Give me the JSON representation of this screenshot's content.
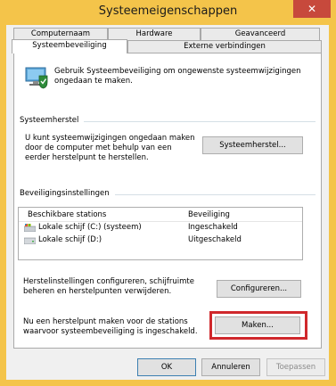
{
  "window": {
    "title": "Systeemeigenschappen",
    "close_glyph": "✕"
  },
  "tabs": {
    "row1": [
      "Computernaam",
      "Hardware",
      "Geavanceerd"
    ],
    "row2": [
      "Systeembeveiliging",
      "Externe verbindingen"
    ],
    "active": "Systeembeveiliging"
  },
  "intro": {
    "icon": "system-protection-icon",
    "text": "Gebruik Systeembeveiliging om ongewenste systeemwijzigingen ongedaan te maken."
  },
  "restore": {
    "group_label": "Systeemherstel",
    "description": "U kunt systeemwijzigingen ongedaan maken door de computer met behulp van een eerder herstelpunt te herstellen.",
    "button": "Systeemherstel..."
  },
  "protection": {
    "group_label": "Beveiligingsinstellingen",
    "columns": [
      "Beschikbare stations",
      "Beveiliging"
    ],
    "drives": [
      {
        "name": "Lokale schijf (C:) (systeem)",
        "status": "Ingeschakeld",
        "icon": "system-drive-icon"
      },
      {
        "name": "Lokale schijf (D:)",
        "status": "Uitgeschakeld",
        "icon": "drive-icon"
      }
    ],
    "configure_text": "Herstelinstellingen configureren, schijfruimte beheren en herstelpunten verwijderen.",
    "configure_button": "Configureren...",
    "create_text": "Nu een herstelpunt maken voor de stations waarvoor systeembeveiliging is ingeschakeld.",
    "create_button": "Maken..."
  },
  "footer": {
    "ok": "OK",
    "cancel": "Annuleren",
    "apply": "Toepassen"
  },
  "colors": {
    "titlebar": "#f4c44a",
    "close": "#c7493c",
    "highlight": "#d0282c"
  }
}
